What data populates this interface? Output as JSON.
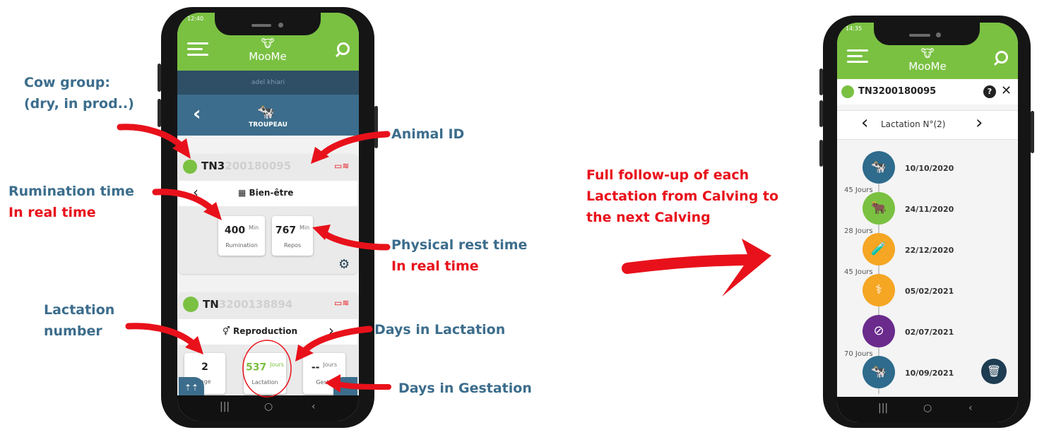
{
  "annotations": {
    "cow_group": [
      "Cow group:",
      "(dry, in prod..)"
    ],
    "animal_id": "Animal ID",
    "rumination": "Rumination time",
    "rumination_rt": "In real time",
    "physical_rest": "Physical rest time",
    "physical_rest_rt": "In real time",
    "lactation_number": [
      "Lactation",
      "number"
    ],
    "days_lactation": "Days in Lactation",
    "days_gestation": "Days in Gestation",
    "followup": [
      "Full follow-up of each",
      "Lactation from Calving to",
      "the next Calving"
    ]
  },
  "phone1": {
    "status_time": "12:40",
    "app_name": "MooMe",
    "user": "adel khiari",
    "herd_label": "TROUPEAU",
    "animal1": {
      "id_prefix": "TN3",
      "id_rest": "200180095"
    },
    "section_welfare": "Bien-être",
    "rumination_value": "400",
    "rumination_unit": "Min",
    "rumination_label": "Rumination",
    "rest_value": "767",
    "rest_unit": "Min",
    "rest_label": "Repos",
    "animal2": {
      "id_prefix": "TN",
      "id_rest": "3200138894"
    },
    "section_repro": "Reproduction",
    "velage_value": "2",
    "velage_label": "lage",
    "lactation_value": "537",
    "lactation_unit": "Jours",
    "lactation_label": "Lactation",
    "gestation_value": "--",
    "gestation_unit": "Jours",
    "gestation_label": "Gesta"
  },
  "phone2": {
    "status_time": "14:35",
    "app_name": "MooMe",
    "animal_id": "TN3200180095",
    "help": "?",
    "lactation_title": "Lactation N°(2)",
    "timeline": [
      {
        "date": "10/10/2020",
        "color": "#2e6b8c",
        "icon": "calving-icon"
      },
      {
        "days": "45 Jours",
        "date": "24/11/2020",
        "color": "#7ac142",
        "icon": "insemination-icon"
      },
      {
        "days": "28 Jours",
        "date": "22/12/2020",
        "color": "#f5a623",
        "icon": "test-tube-icon"
      },
      {
        "days": "45 Jours",
        "date": "05/02/2021",
        "color": "#f5a623",
        "icon": "stethoscope-icon"
      },
      {
        "date": "02/07/2021",
        "color": "#6a2b8c",
        "icon": "dry-off-icon"
      },
      {
        "days": "70 Jours",
        "date": "10/09/2021",
        "color": "#2e6b8c",
        "icon": "calving-icon"
      }
    ]
  },
  "colors": {
    "app_green": "#7ac142",
    "herd_blue": "#3c6d8c",
    "annotation_blue": "#3c6d8c",
    "highlight_red": "#e8111b"
  }
}
